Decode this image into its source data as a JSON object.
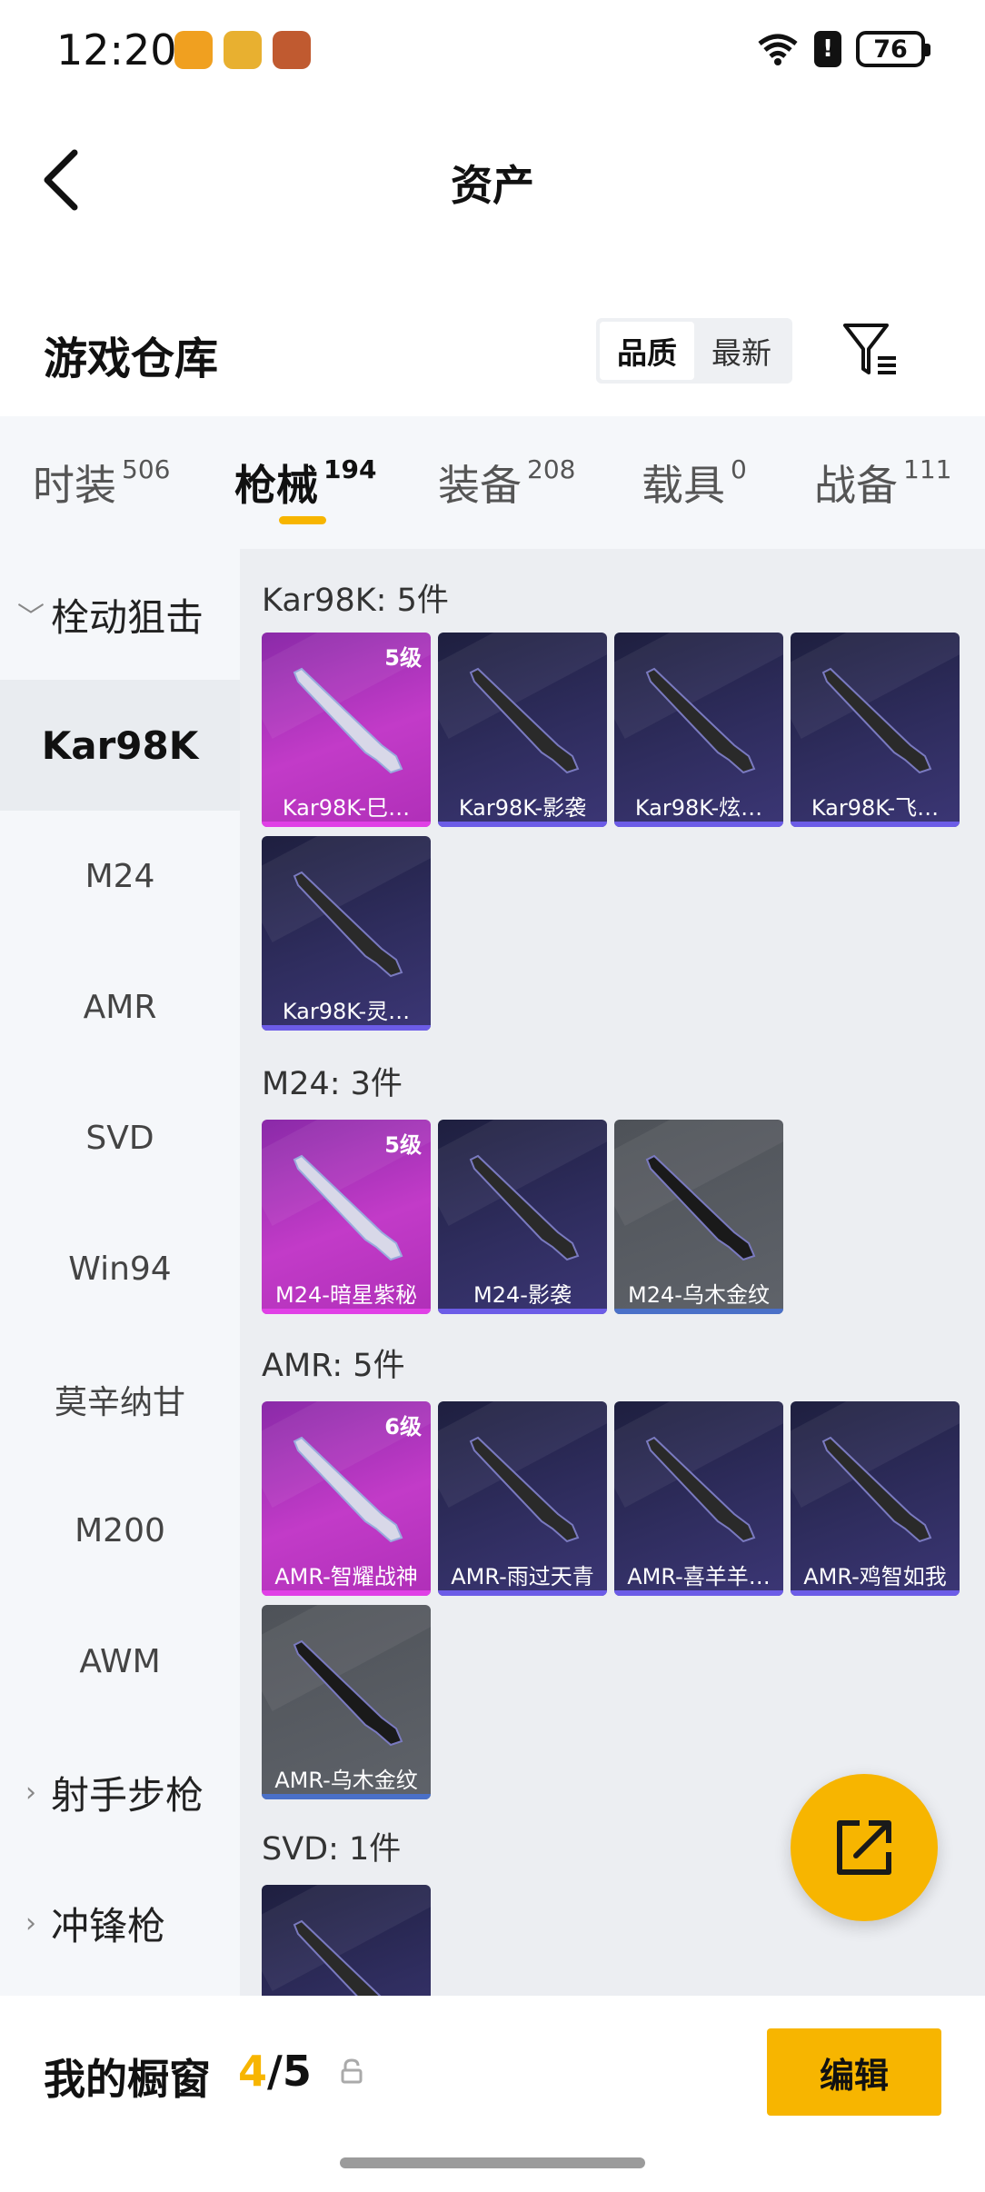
{
  "status_bar": {
    "time": "12:20",
    "battery": "76",
    "alert": "!"
  },
  "header": {
    "title": "资产",
    "back_icon": "chevron-left-icon"
  },
  "section": {
    "title": "游戏仓库",
    "sort_options": [
      "品质",
      "最新"
    ],
    "active_sort": "品质",
    "filter_icon": "filter-icon"
  },
  "tabs": [
    {
      "label": "时装",
      "count": "506"
    },
    {
      "label": "枪械",
      "count": "194",
      "active": true
    },
    {
      "label": "装备",
      "count": "208"
    },
    {
      "label": "载具",
      "count": "0"
    },
    {
      "label": "战备",
      "count": "111"
    }
  ],
  "sidebar": {
    "groups": [
      {
        "label": "栓动狙击",
        "expanded": true
      },
      {
        "label": "射手步枪",
        "expanded": false
      },
      {
        "label": "冲锋枪",
        "expanded": false
      }
    ],
    "items": [
      "Kar98K",
      "M24",
      "AMR",
      "SVD",
      "Win94",
      "莫辛纳甘",
      "M200",
      "AWM"
    ],
    "active_item": "Kar98K"
  },
  "groups": [
    {
      "title": "Kar98K: 5件",
      "items": [
        {
          "name": "Kar98K-巳…",
          "level": "5级",
          "rarity": "gold"
        },
        {
          "name": "Kar98K-影袭",
          "rarity": "purple"
        },
        {
          "name": "Kar98K-炫…",
          "rarity": "purple"
        },
        {
          "name": "Kar98K-飞…",
          "rarity": "purple"
        },
        {
          "name": "Kar98K-灵…",
          "rarity": "purple"
        }
      ]
    },
    {
      "title": "M24: 3件",
      "items": [
        {
          "name": "M24-暗星紫秘",
          "level": "5级",
          "rarity": "gold"
        },
        {
          "name": "M24-影袭",
          "rarity": "purple"
        },
        {
          "name": "M24-乌木金纹",
          "rarity": "grey"
        }
      ]
    },
    {
      "title": "AMR: 5件",
      "items": [
        {
          "name": "AMR-智耀战神",
          "level": "6级",
          "rarity": "gold"
        },
        {
          "name": "AMR-雨过天青",
          "rarity": "purple"
        },
        {
          "name": "AMR-喜羊羊…",
          "rarity": "purple"
        },
        {
          "name": "AMR-鸡智如我",
          "rarity": "purple"
        },
        {
          "name": "AMR-乌木金纹",
          "rarity": "grey"
        }
      ]
    },
    {
      "title": "SVD: 1件",
      "items": [
        {
          "name": "",
          "rarity": "purple"
        }
      ]
    }
  ],
  "fab": {
    "icon": "share-icon"
  },
  "showcase": {
    "label": "我的橱窗",
    "current": "4",
    "total": "/5",
    "edit_label": "编辑"
  },
  "colors": {
    "accent": "#f7b500",
    "gold_card": "#c23bc8",
    "purple_card": "#2f2d5e",
    "grey_card": "#5f636a"
  }
}
